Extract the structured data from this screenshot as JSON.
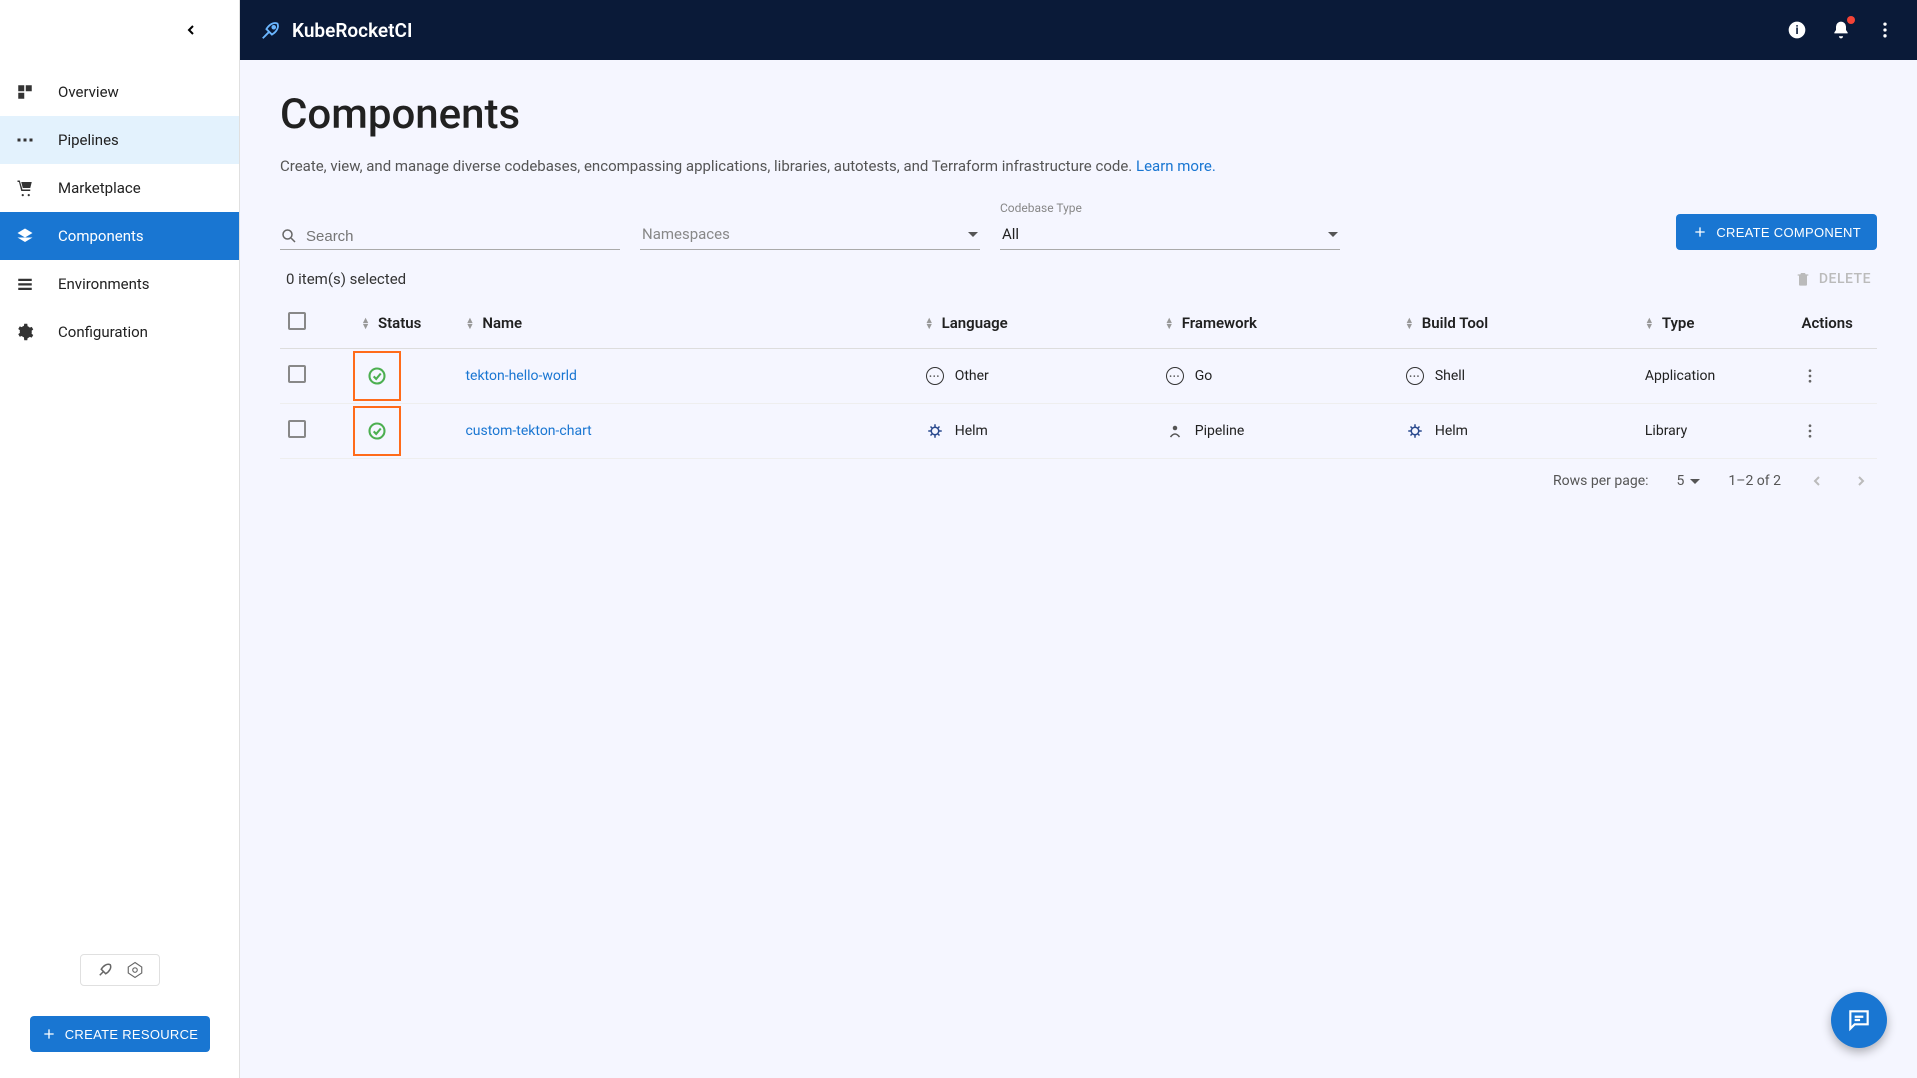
{
  "header": {
    "brand": "KubeRocketCI"
  },
  "sidebar": {
    "items": [
      {
        "label": "Overview"
      },
      {
        "label": "Pipelines"
      },
      {
        "label": "Marketplace"
      },
      {
        "label": "Components"
      },
      {
        "label": "Environments"
      },
      {
        "label": "Configuration"
      }
    ],
    "create_resource": "CREATE RESOURCE"
  },
  "page": {
    "title": "Components",
    "description": "Create, view, and manage diverse codebases, encompassing applications, libraries, autotests, and Terraform infrastructure code.",
    "learn_more": "Learn more."
  },
  "filters": {
    "search_placeholder": "Search",
    "namespaces_placeholder": "Namespaces",
    "codebase_type_label": "Codebase Type",
    "codebase_type_value": "All",
    "create_component": "CREATE COMPONENT"
  },
  "selection": {
    "text": "0 item(s) selected",
    "delete": "DELETE"
  },
  "table": {
    "headers": {
      "status": "Status",
      "name": "Name",
      "language": "Language",
      "framework": "Framework",
      "build_tool": "Build Tool",
      "type": "Type",
      "actions": "Actions"
    },
    "rows": [
      {
        "name": "tekton-hello-world",
        "language": "Other",
        "framework": "Go",
        "build_tool": "Shell",
        "type": "Application"
      },
      {
        "name": "custom-tekton-chart",
        "language": "Helm",
        "framework": "Pipeline",
        "build_tool": "Helm",
        "type": "Library"
      }
    ]
  },
  "pagination": {
    "rows_per_page_label": "Rows per page:",
    "rows_per_page_value": "5",
    "range": "1–2 of 2"
  }
}
